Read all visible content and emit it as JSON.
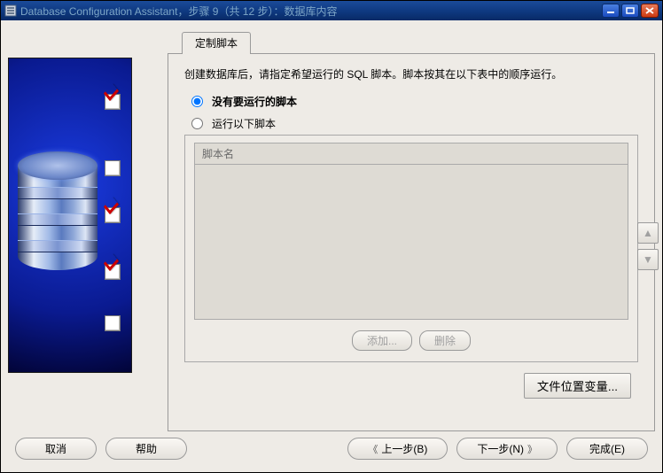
{
  "window": {
    "title": "Database Configuration Assistant，步骤 9（共 12 步）：数据库内容"
  },
  "steps": [
    {
      "checked": true
    },
    {
      "checked": false
    },
    {
      "checked": true
    },
    {
      "checked": true
    },
    {
      "checked": false
    }
  ],
  "tab": {
    "label": "定制脚本"
  },
  "content": {
    "instruction": "创建数据库后，请指定希望运行的 SQL 脚本。脚本按其在以下表中的顺序运行。",
    "radio_none": "没有要运行的脚本",
    "radio_run": "运行以下脚本",
    "header_name": "脚本名",
    "add_btn": "添加...",
    "del_btn": "删除",
    "file_vars_btn": "文件位置变量..."
  },
  "nav": {
    "cancel": "取消",
    "help": "帮助",
    "back": "上一步(B)",
    "next": "下一步(N)",
    "finish": "完成(E)"
  },
  "icons": {
    "up": "▲",
    "down": "▼",
    "back": "《",
    "next": "》"
  }
}
